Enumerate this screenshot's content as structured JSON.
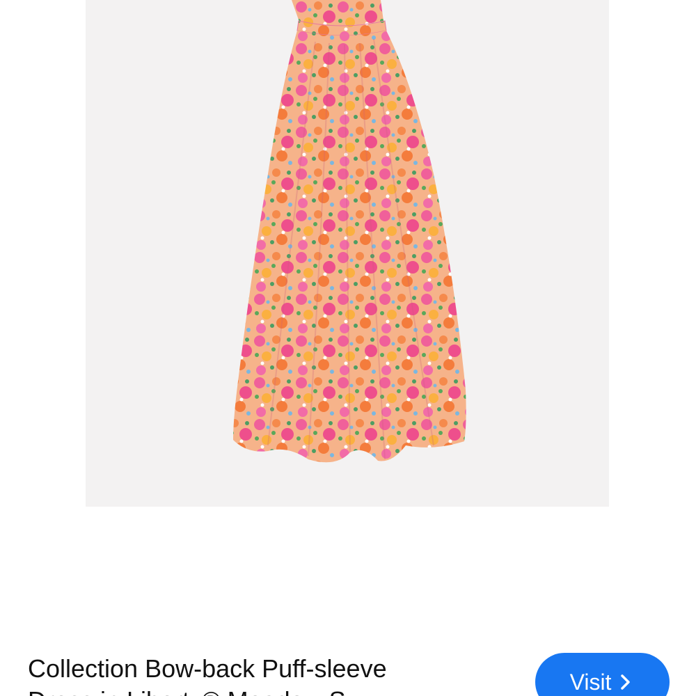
{
  "product": {
    "image_alt": "Floral maxi dress",
    "title_line1": "Collection Bow-back Puff-sleeve",
    "title_line2": "Dress in Liberty® Meadow S"
  },
  "actions": {
    "visit_label": "Visit",
    "visit_icon": "chevron-right-icon"
  },
  "colors": {
    "image_background": "#f3f2f2",
    "accent_button": "#1877f2",
    "dress_pink": "#f0609a",
    "dress_orange": "#f58a4c",
    "dress_green": "#5aa85a"
  }
}
